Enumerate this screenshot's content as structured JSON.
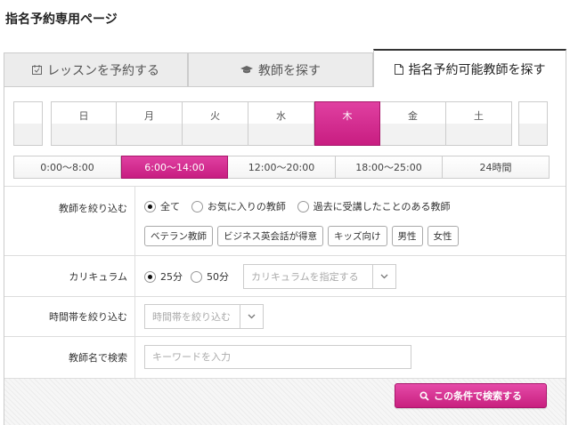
{
  "page_title": "指名予約専用ページ",
  "tabs": [
    {
      "label": "レッスンを予約する",
      "icon": "calendar-check-icon"
    },
    {
      "label": "教師を探す",
      "icon": "graduation-cap-icon"
    },
    {
      "label": "指名予約可能教師を探す",
      "icon": "document-icon",
      "active": true
    }
  ],
  "days": [
    "日",
    "月",
    "火",
    "水",
    "木",
    "金",
    "土"
  ],
  "selected_day": "木",
  "time_slots": [
    "0:00〜8:00",
    "6:00〜14:00",
    "12:00〜20:00",
    "18:00〜25:00",
    "24時間"
  ],
  "selected_time": "6:00〜14:00",
  "filters": {
    "teacher": {
      "label": "教師を絞り込む",
      "options": [
        "全て",
        "お気に入りの教師",
        "過去に受講したことのある教師"
      ],
      "selected": "全て",
      "tags": [
        "ベテラン教師",
        "ビジネス英会話が得意",
        "キッズ向け",
        "男性",
        "女性"
      ]
    },
    "curriculum": {
      "label": "カリキュラム",
      "options": [
        "25分",
        "50分"
      ],
      "selected": "25分",
      "select_placeholder": "カリキュラムを指定する"
    },
    "time_band": {
      "label": "時間帯を絞り込む",
      "select_placeholder": "時間帯を絞り込む"
    },
    "name_search": {
      "label": "教師名で検索",
      "placeholder": "キーワードを入力"
    }
  },
  "search_button": "この条件で検索する",
  "colors": {
    "accent": "#d4278e",
    "border": "#cccccc"
  }
}
